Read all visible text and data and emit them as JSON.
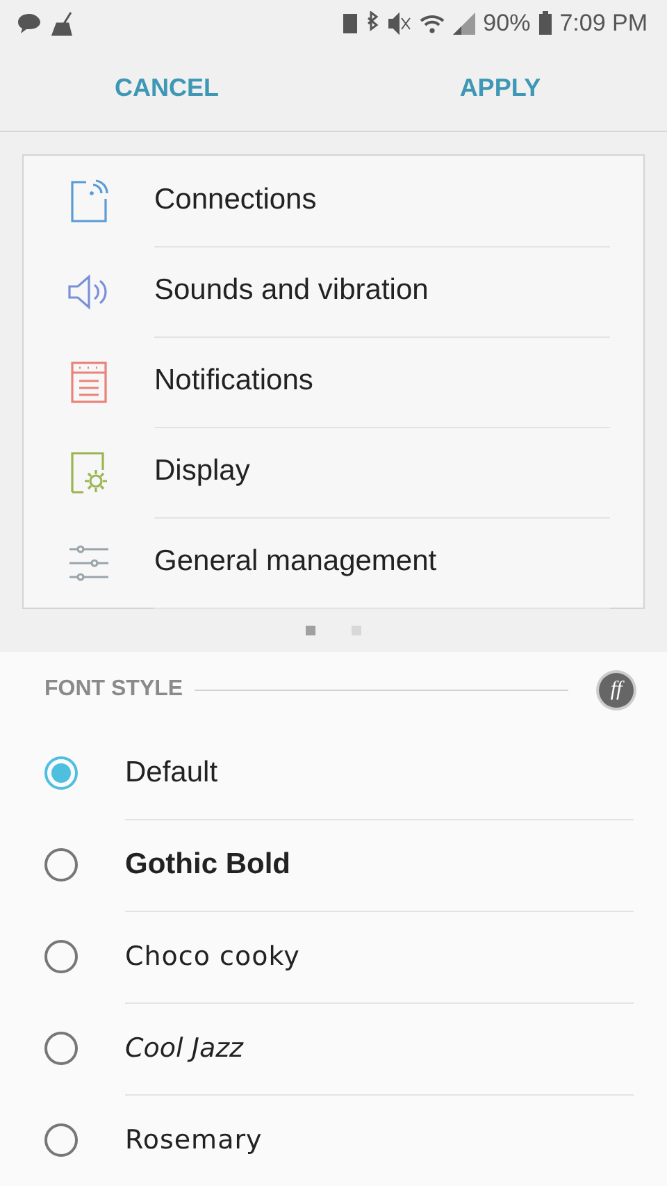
{
  "status_bar": {
    "battery": "90%",
    "time": "7:09 PM"
  },
  "actions": [
    "CANCEL",
    "APPLY"
  ],
  "preview_items": [
    {
      "label": "Connections"
    },
    {
      "label": "Sounds and vibration"
    },
    {
      "label": "Notifications"
    },
    {
      "label": "Display"
    },
    {
      "label": "General management"
    }
  ],
  "pages": [
    {
      "selected": true
    },
    {
      "selected": false
    }
  ],
  "font_style": {
    "heading": "FONT STYLE",
    "badge": "ff",
    "options": [
      {
        "label": "Default",
        "kind": "regular",
        "selected": true
      },
      {
        "label": "Gothic Bold",
        "kind": "bold",
        "selected": false
      },
      {
        "label": "Choco cooky",
        "kind": "script",
        "selected": false
      },
      {
        "label": "Cool Jazz",
        "kind": "script-italic",
        "selected": false
      },
      {
        "label": "Rosemary",
        "kind": "script",
        "selected": false
      }
    ]
  }
}
